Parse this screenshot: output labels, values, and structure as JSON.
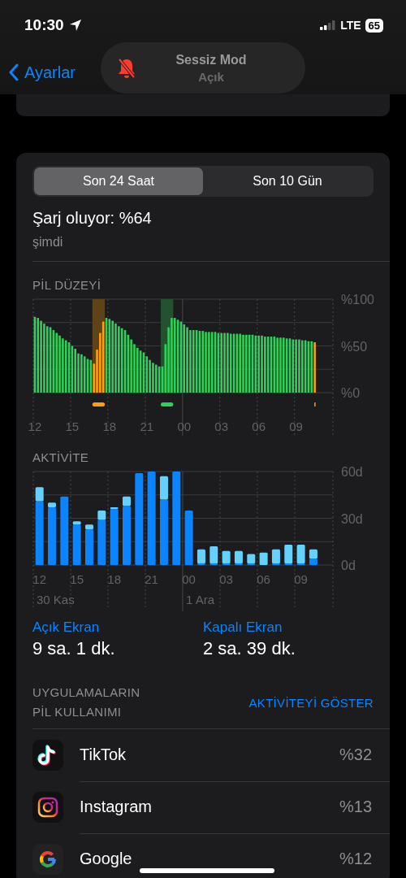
{
  "status_bar": {
    "time": "10:30",
    "network": "LTE",
    "battery": "65"
  },
  "nav": {
    "back": "Ayarlar"
  },
  "banner": {
    "title": "Sessiz Mod",
    "subtitle": "Açık"
  },
  "segments": [
    {
      "label": "Son 24 Saat",
      "selected": true
    },
    {
      "label": "Son 10 Gün",
      "selected": false
    }
  ],
  "charge": {
    "status": "Şarj oluyor: %64",
    "time": "şimdi"
  },
  "battery_level": {
    "title": "PİL DÜZEYİ",
    "chart_data": {
      "type": "bar",
      "ylim": [
        0,
        100
      ],
      "categories": [
        "12",
        null,
        null,
        null,
        null,
        null,
        null,
        null,
        null,
        null,
        null,
        null,
        "15",
        null,
        null,
        null,
        null,
        null,
        null,
        null,
        null,
        null,
        null,
        null,
        "18",
        null,
        null,
        null,
        null,
        null,
        null,
        null,
        null,
        null,
        null,
        null,
        "21",
        null,
        null,
        null,
        null,
        null,
        null,
        null,
        null,
        null,
        null,
        null,
        "00",
        null,
        null,
        null,
        null,
        null,
        null,
        null,
        null,
        null,
        null,
        null,
        "03",
        null,
        null,
        null,
        null,
        null,
        null,
        null,
        null,
        null,
        null,
        null,
        "06",
        null,
        null,
        null,
        null,
        null,
        null,
        null,
        null,
        null,
        null,
        null,
        "09",
        null,
        null,
        null,
        null,
        null,
        null
      ],
      "yticks": [
        {
          "value": 0,
          "label": "%0"
        },
        {
          "value": 50,
          "label": "%50"
        },
        {
          "value": 100,
          "label": "%100"
        }
      ],
      "series": [
        {
          "color": "#30d158",
          "values": [
            81,
            80,
            77,
            74,
            71,
            70,
            67,
            64,
            61,
            58,
            56,
            54,
            50,
            47,
            42,
            41,
            39,
            36,
            35,
            null,
            null,
            null,
            null,
            80,
            79,
            77,
            74,
            71,
            69,
            67,
            62,
            57,
            52,
            48,
            45,
            43,
            39,
            35,
            32,
            30,
            28,
            28,
            52,
            70,
            80,
            80,
            78,
            76,
            73,
            70,
            67,
            67,
            67,
            66,
            66,
            65,
            65,
            65,
            65,
            64,
            64,
            64,
            64,
            63,
            63,
            63,
            63,
            62,
            62,
            62,
            62,
            61,
            61,
            61,
            60,
            60,
            60,
            60,
            59,
            59,
            59,
            58,
            58,
            57,
            57,
            57,
            56,
            56,
            55,
            55,
            null
          ]
        },
        {
          "color": "#ff9f0a",
          "values": [
            null,
            null,
            null,
            null,
            null,
            null,
            null,
            null,
            null,
            null,
            null,
            null,
            null,
            null,
            null,
            null,
            null,
            null,
            null,
            31,
            46,
            64,
            76,
            null,
            null,
            null,
            null,
            null,
            null,
            null,
            null,
            null,
            null,
            null,
            null,
            null,
            null,
            null,
            null,
            null,
            null,
            null,
            null,
            null,
            null,
            null,
            null,
            null,
            null,
            null,
            null,
            null,
            null,
            null,
            null,
            null,
            null,
            null,
            null,
            null,
            null,
            null,
            null,
            null,
            null,
            null,
            null,
            null,
            null,
            null,
            null,
            null,
            null,
            null,
            null,
            null,
            null,
            null,
            null,
            null,
            null,
            null,
            null,
            null,
            null,
            null,
            null,
            null,
            null,
            null,
            54
          ]
        }
      ]
    }
  },
  "activity": {
    "title": "AKTİVİTE",
    "chart_data": {
      "type": "bar",
      "stacked": true,
      "ylim": [
        0,
        60
      ],
      "categories": [
        "12",
        null,
        null,
        "15",
        null,
        null,
        "18",
        null,
        null,
        "21",
        null,
        null,
        "00",
        null,
        null,
        "03",
        null,
        null,
        "06",
        null,
        null,
        "09",
        null
      ],
      "yticks": [
        {
          "value": 0,
          "label": "0d"
        },
        {
          "value": 30,
          "label": "30d"
        },
        {
          "value": 60,
          "label": "60d"
        }
      ],
      "series": [
        {
          "color": "#0a84ff",
          "values": [
            41,
            37,
            44,
            26,
            23,
            29,
            36,
            38,
            59,
            60,
            42,
            60,
            35,
            1,
            1,
            1,
            1,
            1,
            0,
            1,
            1,
            1,
            4
          ]
        },
        {
          "color": "#64d2ff",
          "values": [
            9,
            3,
            0,
            2,
            3,
            6,
            1,
            6,
            0,
            0,
            15,
            0,
            0,
            9,
            11,
            8,
            8,
            6,
            8,
            9,
            12,
            12,
            6
          ]
        }
      ]
    },
    "dates": [
      "30 Kas",
      "1 Ara"
    ]
  },
  "screen_on": {
    "label": "Açık Ekran",
    "value": "9 sa. 1 dk."
  },
  "screen_off": {
    "label": "Kapalı Ekran",
    "value": "2 sa. 39 dk."
  },
  "apps": {
    "title": "UYGULAMALARIN PİL KULLANIMI",
    "action": "AKTİVİTEYİ GÖSTER",
    "rows": [
      {
        "kind": "tiktok",
        "name": "TikTok",
        "percent": "%32"
      },
      {
        "kind": "instagram",
        "name": "Instagram",
        "percent": "%13"
      },
      {
        "kind": "google",
        "name": "Google",
        "percent": "%12"
      }
    ]
  }
}
